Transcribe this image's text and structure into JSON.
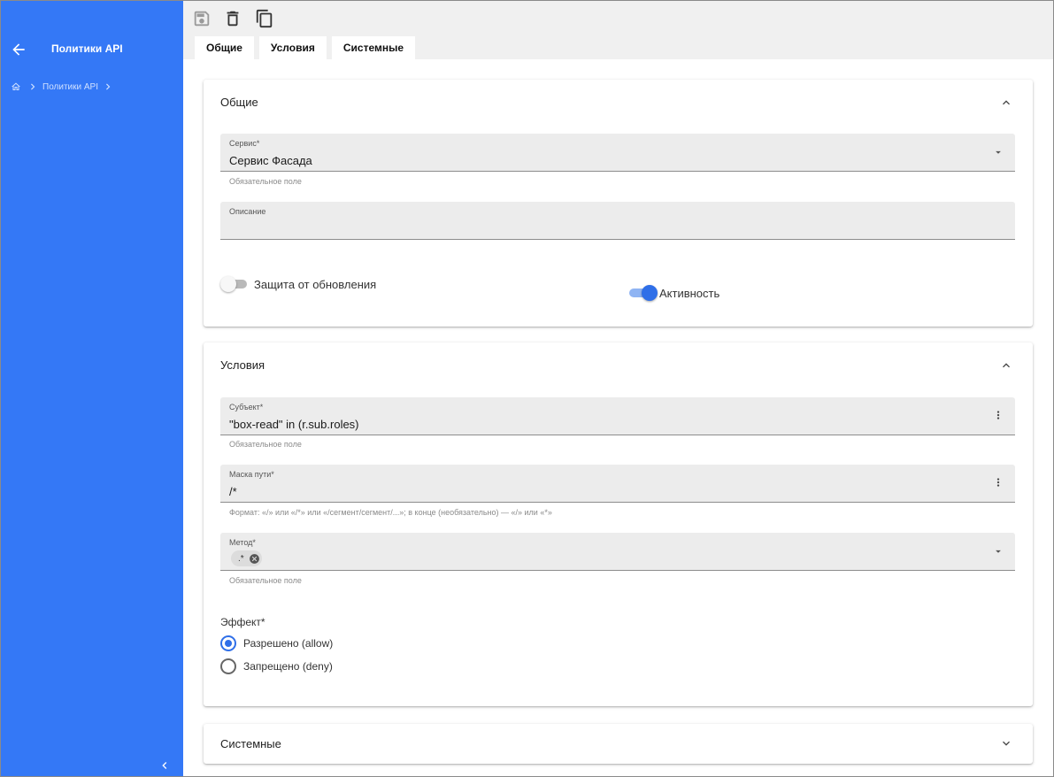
{
  "sidebar": {
    "title": "Политики API",
    "breadcrumb": [
      "Политики API"
    ]
  },
  "toolbar": {
    "icons": [
      "save-icon",
      "delete-icon",
      "copy-icon"
    ]
  },
  "tabs": [
    {
      "label": "Общие"
    },
    {
      "label": "Условия"
    },
    {
      "label": "Системные"
    }
  ],
  "general": {
    "title": "Общие",
    "service": {
      "label": "Сервис*",
      "value": "Сервис Фасада",
      "hint": "Обязательное поле"
    },
    "description": {
      "label": "Описание",
      "value": ""
    },
    "update_protection": {
      "label": "Защита от обновления",
      "on": false
    },
    "active": {
      "label": "Активность",
      "on": true
    }
  },
  "conditions": {
    "title": "Условия",
    "subject": {
      "label": "Субъект*",
      "value": "\"box-read\" in (r.sub.roles)",
      "hint": "Обязательное поле"
    },
    "path_mask": {
      "label": "Маска пути*",
      "value": "/*",
      "hint": "Формат: «/» или «/*» или «/сегмент/сегмент/...»; в конце (необязательно) — «/» или «*»"
    },
    "method": {
      "label": "Метод*",
      "chip": ".*",
      "hint": "Обязательное поле"
    },
    "effect": {
      "label": "Эффект*",
      "options": [
        {
          "label": "Разрешено (allow)",
          "selected": true
        },
        {
          "label": "Запрещено (deny)",
          "selected": false
        }
      ]
    }
  },
  "system": {
    "title": "Системные"
  },
  "colors": {
    "sidebar": "#3478f6",
    "accent": "#2f6fe8",
    "field_bg": "#ececec"
  }
}
